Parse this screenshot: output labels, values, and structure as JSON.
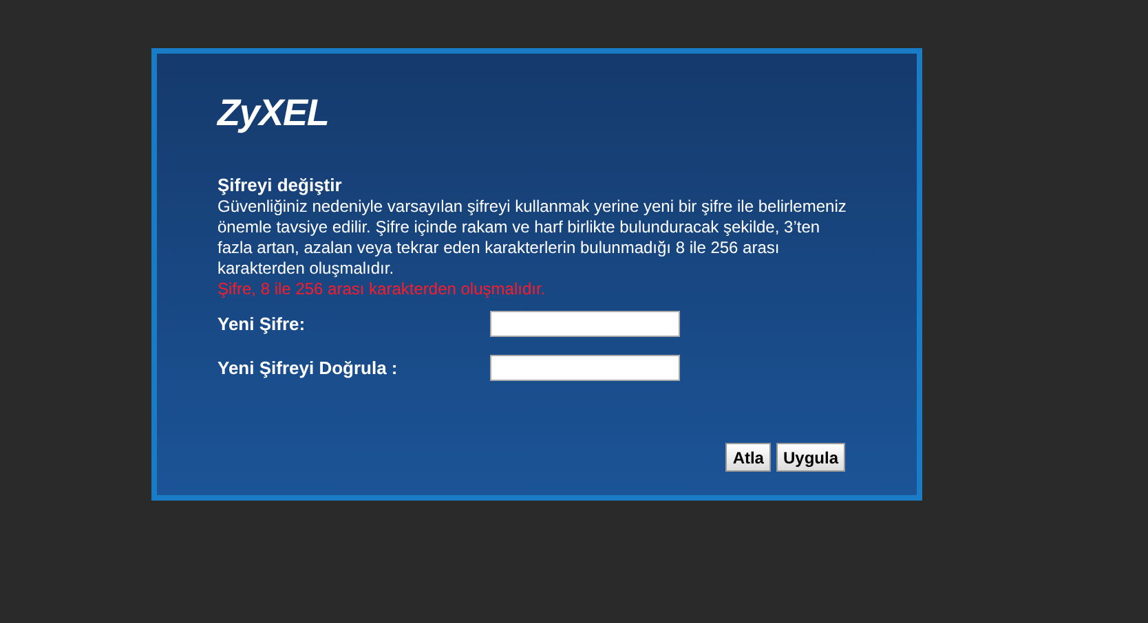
{
  "logo": "ZyXEL",
  "title": "Şifreyi değiştir",
  "description": "Güvenliğiniz nedeniyle varsayılan şifreyi kullanmak yerine yeni bir şifre ile belirlemeniz önemle tavsiye edilir. Şifre içinde rakam ve harf birlikte bulunduracak şekilde, 3’ten fazla artan, azalan veya tekrar eden karakterlerin bulunmadığı 8 ile 256 arası karakterden oluşmalıdır.",
  "error": "Şifre, 8 ile 256 arası karakterden oluşmalıdır.",
  "fields": [
    {
      "label": "Yeni Şifre:"
    },
    {
      "label": "Yeni Şifreyi Doğrula :"
    }
  ],
  "buttons": [
    "Atla",
    "Uygula"
  ]
}
